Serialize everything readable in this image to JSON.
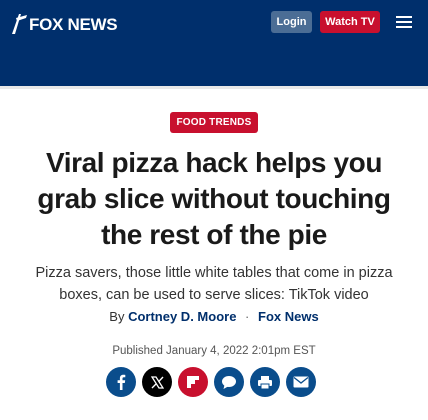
{
  "header": {
    "logo": "FOX NEWS",
    "login_label": "Login",
    "watch_label": "Watch TV",
    "colors": {
      "nav": "#002f6c",
      "accent_red": "#c8102e",
      "login_bg": "#4b6d95"
    }
  },
  "article": {
    "eyebrow": "FOOD TRENDS",
    "headline": "Viral pizza hack helps you grab slice without touching the rest of the pie",
    "subhead": "Pizza savers, those little white tables that come in pizza boxes, can be used to serve slices: TikTok video",
    "byline_prefix": "By",
    "author": "Cortney D. Moore",
    "separator": "·",
    "source": "Fox News",
    "published": "Published January 4, 2022 2:01pm EST"
  },
  "share": {
    "items": [
      {
        "icon": "facebook-icon",
        "color": "#0a4d8c"
      },
      {
        "icon": "x-twitter-icon",
        "color": "#000000"
      },
      {
        "icon": "flipboard-icon",
        "color": "#c8102e"
      },
      {
        "icon": "comments-icon",
        "color": "#0a4d8c"
      },
      {
        "icon": "print-icon",
        "color": "#0a4d8c"
      },
      {
        "icon": "email-icon",
        "color": "#0a4d8c"
      }
    ]
  }
}
